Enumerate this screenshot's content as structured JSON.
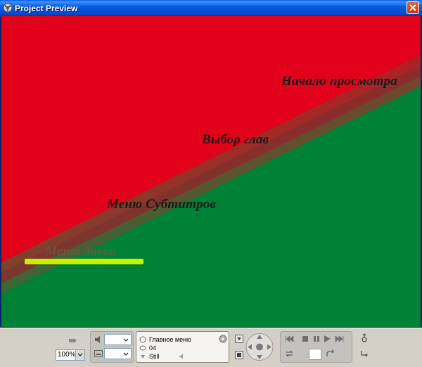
{
  "window": {
    "title": "Project Preview"
  },
  "preview": {
    "colors": {
      "top": "#e2001a",
      "bottom": "#008236",
      "band": "#8a2a2a",
      "highlight": "#c8f000"
    },
    "menu_items": [
      {
        "label": "Начало просмотра"
      },
      {
        "label": "Выбор глав"
      },
      {
        "label": "Меню Субтитров"
      },
      {
        "label": "Меню Звука"
      }
    ]
  },
  "controls": {
    "zoom": "100%",
    "info": {
      "menu_name": "Главное меню",
      "number": "04",
      "status": "Still"
    },
    "icons": [
      "pointer-icon",
      "audio-icon",
      "subtitle-icon",
      "dvd-icon",
      "menu-icon",
      "title-icon",
      "nav-arrows-icon",
      "first-icon",
      "stop-icon",
      "pause-icon",
      "play-icon",
      "last-icon",
      "loop-icon",
      "jump-icon",
      "settings-icon"
    ]
  }
}
